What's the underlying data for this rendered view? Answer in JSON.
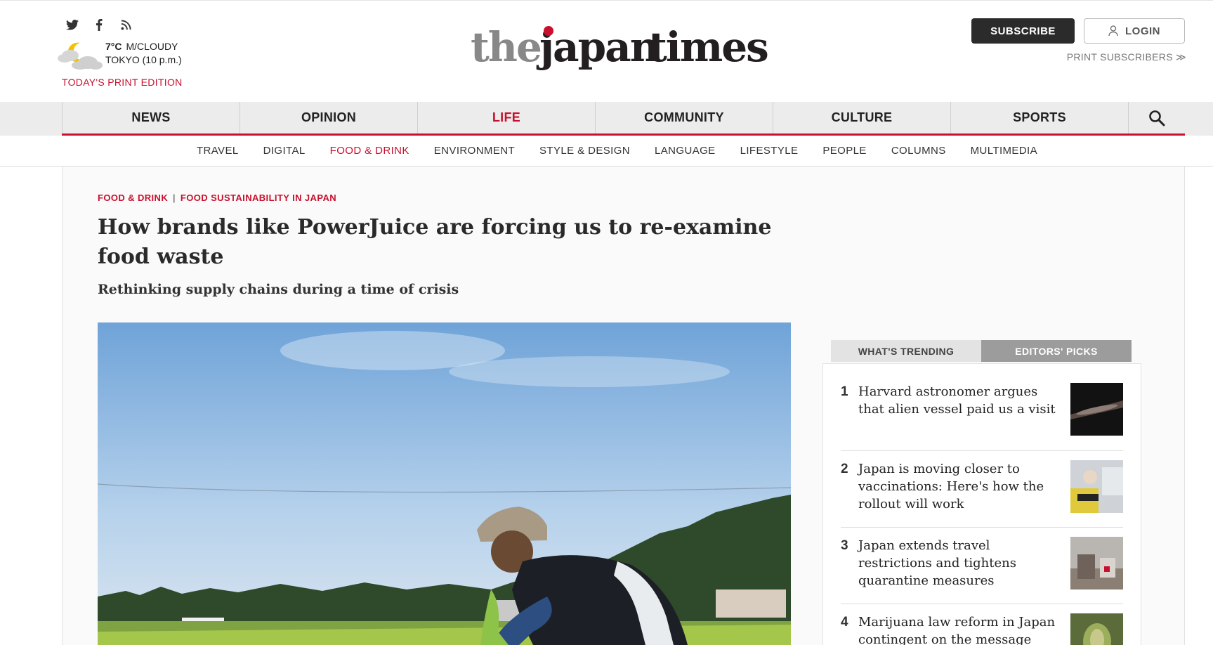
{
  "header": {
    "social": [
      "twitter-icon",
      "facebook-icon",
      "rss-icon"
    ],
    "weather": {
      "temp": "7°C",
      "condition": "M/CLOUDY",
      "location": "TOKYO (10 p.m.)"
    },
    "print_edition": "TODAY'S PRINT EDITION",
    "logo": {
      "part1": "the",
      "part2": "japan",
      "part3": "times"
    },
    "subscribe": "SUBSCRIBE",
    "login": "LOGIN",
    "print_subscribers": "PRINT SUBSCRIBERS ≫"
  },
  "nav": {
    "items": [
      "NEWS",
      "OPINION",
      "LIFE",
      "COMMUNITY",
      "CULTURE",
      "SPORTS"
    ],
    "active": "LIFE"
  },
  "subnav": {
    "items": [
      "TRAVEL",
      "DIGITAL",
      "FOOD & DRINK",
      "ENVIRONMENT",
      "STYLE & DESIGN",
      "LANGUAGE",
      "LIFESTYLE",
      "PEOPLE",
      "COLUMNS",
      "MULTIMEDIA"
    ],
    "active": "FOOD & DRINK"
  },
  "article": {
    "category": "FOOD & DRINK",
    "series": "FOOD SUSTAINABILITY IN JAPAN",
    "headline": "How brands like PowerJuice are forcing us to re-examine food waste",
    "subhead": "Rethinking supply chains during a time of crisis"
  },
  "sidebar": {
    "tabs": [
      "WHAT'S TRENDING",
      "EDITORS' PICKS"
    ],
    "trending": [
      {
        "num": "1",
        "title": "Harvard astronomer argues that alien vessel paid us a visit",
        "thumb": "comet-thumbnail"
      },
      {
        "num": "2",
        "title": "Japan is moving closer to vaccinations: Here's how the rollout will work",
        "thumb": "vaccination-thumbnail"
      },
      {
        "num": "3",
        "title": "Japan extends travel restrictions and tightens quarantine measures",
        "thumb": "airport-thumbnail"
      },
      {
        "num": "4",
        "title": "Marijuana law reform in Japan contingent on the message",
        "thumb": "cannabis-thumbnail"
      }
    ]
  },
  "colors": {
    "accent": "#c8102e",
    "dark": "#2b2b2b",
    "nav_bg": "#ececec"
  }
}
